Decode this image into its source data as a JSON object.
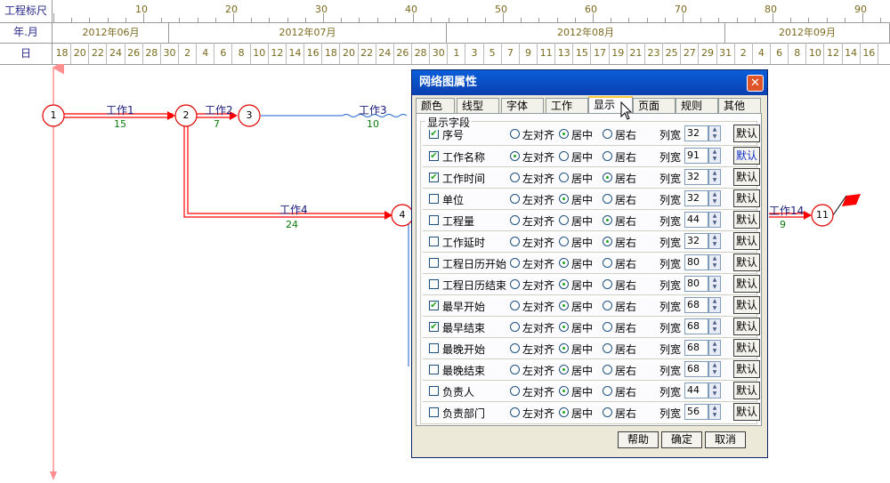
{
  "ruler": {
    "scale_label": "工程标尺",
    "year_month_label": "年.月",
    "day_label": "日",
    "scale_numbers": [
      "10",
      "20",
      "30",
      "40",
      "50",
      "60",
      "70",
      "80",
      "90"
    ],
    "months": [
      "2012年06月",
      "2012年07月",
      "2012年08月",
      "2012年09月"
    ],
    "days": [
      "18",
      "20",
      "22",
      "24",
      "26",
      "28",
      "30",
      "2",
      "4",
      "6",
      "8",
      "10",
      "12",
      "14",
      "16",
      "18",
      "20",
      "22",
      "24",
      "26",
      "28",
      "30",
      "1",
      "3",
      "5",
      "7",
      "9",
      "11",
      "13",
      "15",
      "17",
      "19",
      "21",
      "23",
      "25",
      "27",
      "29",
      "31",
      "2",
      "4",
      "6",
      "8",
      "10",
      "12",
      "14",
      "16"
    ]
  },
  "network": {
    "nodes": [
      "1",
      "2",
      "3",
      "4",
      "11"
    ],
    "tasks": [
      {
        "name": "工作1",
        "duration": "15"
      },
      {
        "name": "工作2",
        "duration": "7"
      },
      {
        "name": "工作3",
        "duration": "10"
      },
      {
        "name": "工作4",
        "duration": "24"
      },
      {
        "name": "工作14",
        "duration": "9"
      }
    ],
    "colors": {
      "critical": "#ff0000",
      "normal": "#1a5fcf",
      "node_border": "#e00000",
      "grid": "#9a9a9a"
    }
  },
  "dialog": {
    "title": "网络图属性",
    "tabs": [
      "颜色",
      "线型",
      "字体",
      "工作",
      "显示",
      "页面",
      "规则",
      "其他"
    ],
    "active_tab": "显示",
    "group_title": "显示字段",
    "align_left": "左对齐",
    "align_center": "居中",
    "align_right": "居右",
    "width_label": "列宽",
    "default_label": "默认",
    "fields": [
      {
        "name": "序号",
        "checked": true,
        "align": "center",
        "width": "32"
      },
      {
        "name": "工作名称",
        "checked": true,
        "align": "left",
        "width": "91"
      },
      {
        "name": "工作时间",
        "checked": true,
        "align": "right",
        "width": "32"
      },
      {
        "name": "单位",
        "checked": false,
        "align": "center",
        "width": "32"
      },
      {
        "name": "工程量",
        "checked": false,
        "align": "right",
        "width": "44"
      },
      {
        "name": "工作延时",
        "checked": false,
        "align": "right",
        "width": "32"
      },
      {
        "name": "工程日历开始",
        "checked": false,
        "align": "center",
        "width": "80"
      },
      {
        "name": "工程日历结束",
        "checked": false,
        "align": "center",
        "width": "80"
      },
      {
        "name": "最早开始",
        "checked": true,
        "align": "center",
        "width": "68"
      },
      {
        "name": "最早结束",
        "checked": true,
        "align": "center",
        "width": "68"
      },
      {
        "name": "最晚开始",
        "checked": false,
        "align": "center",
        "width": "68"
      },
      {
        "name": "最晚结束",
        "checked": false,
        "align": "center",
        "width": "68"
      },
      {
        "name": "负责人",
        "checked": false,
        "align": "center",
        "width": "44"
      },
      {
        "name": "负责部门",
        "checked": false,
        "align": "center",
        "width": "56"
      }
    ],
    "buttons": {
      "help": "帮助",
      "ok": "确定",
      "cancel": "取消"
    }
  }
}
